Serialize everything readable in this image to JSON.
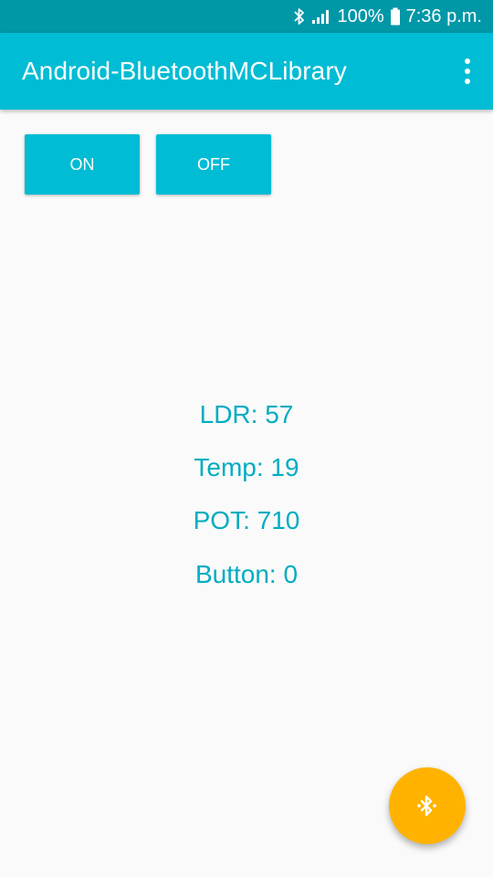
{
  "status_bar": {
    "battery_percent": "100%",
    "time": "7:36 p.m.",
    "icons": [
      "bluetooth-icon",
      "signal-icon",
      "battery-icon"
    ]
  },
  "app_bar": {
    "title": "Android-BluetoothMCLibrary",
    "menu_icon": "overflow-menu-icon"
  },
  "controls": {
    "on_label": "ON",
    "off_label": "OFF"
  },
  "readings": {
    "ldr": "LDR: 57",
    "temp": "Temp: 19",
    "pot": "POT: 710",
    "button": "Button: 0"
  },
  "fab": {
    "icon": "bluetooth-searching-icon"
  },
  "colors": {
    "status_bar": "#0097a7",
    "primary": "#00bcd4",
    "reading_text": "#00acc1",
    "fab": "#ffb300",
    "background": "#fafafa"
  }
}
